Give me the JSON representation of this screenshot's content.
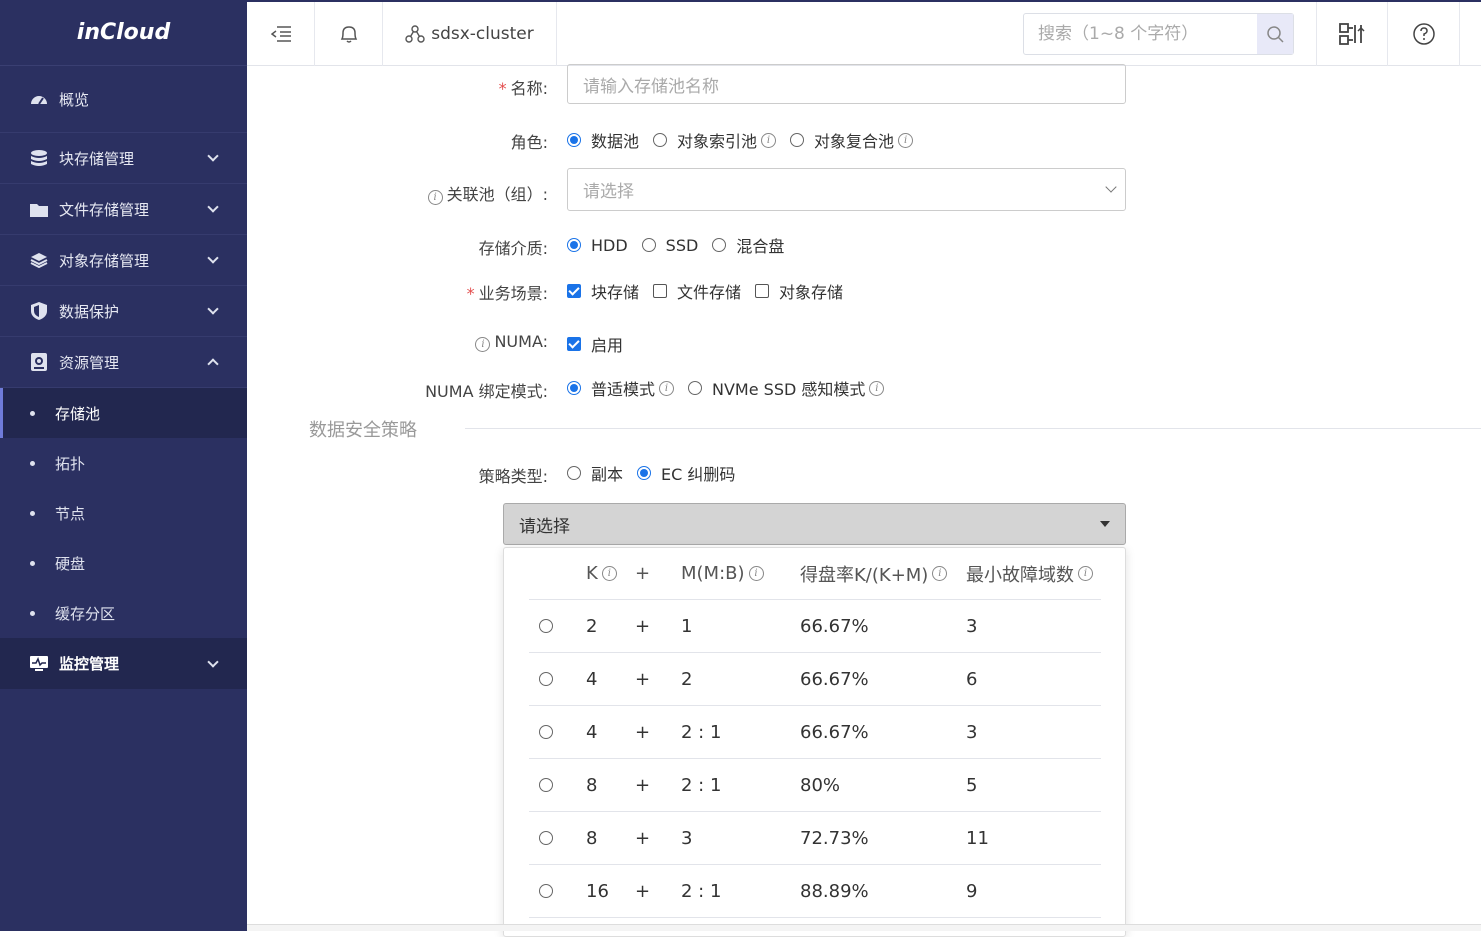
{
  "brand": {
    "logo_text": "inCloud"
  },
  "sidebar": {
    "items": [
      {
        "label": "概览",
        "icon": "dashboard-icon"
      },
      {
        "label": "块存储管理",
        "icon": "block-storage-icon"
      },
      {
        "label": "文件存储管理",
        "icon": "folder-icon"
      },
      {
        "label": "对象存储管理",
        "icon": "layers-icon"
      },
      {
        "label": "数据保护",
        "icon": "shield-icon"
      },
      {
        "label": "资源管理",
        "icon": "resource-icon"
      }
    ],
    "sub_items": [
      "存储池",
      "拓扑",
      "节点",
      "硬盘",
      "缓存分区"
    ],
    "monitor": {
      "label": "监控管理",
      "icon": "monitor-icon"
    }
  },
  "topbar": {
    "cluster": "sdsx-cluster",
    "search_placeholder": "搜索（1~8 个字符）"
  },
  "form": {
    "name": {
      "label": "名称:",
      "placeholder": "请输入存储池名称"
    },
    "role": {
      "label": "角色:",
      "options": [
        "数据池",
        "对象索引池",
        "对象复合池"
      ],
      "selected": 0
    },
    "linked_pool": {
      "label": "关联池（组）:",
      "placeholder": "请选择"
    },
    "media": {
      "label": "存储介质:",
      "options": [
        "HDD",
        "SSD",
        "混合盘"
      ],
      "selected": 0
    },
    "scenario": {
      "label": "业务场景:",
      "options": [
        "块存储",
        "文件存储",
        "对象存储"
      ],
      "checked": [
        true,
        false,
        false
      ]
    },
    "numa": {
      "label": "NUMA:",
      "option": "启用",
      "checked": true
    },
    "numa_mode": {
      "label": "NUMA 绑定模式:",
      "options": [
        "普适模式",
        "NVMe SSD 感知模式"
      ],
      "selected": 0
    },
    "section_title": "数据安全策略",
    "policy": {
      "label": "策略类型:",
      "options": [
        "副本",
        "EC 纠删码"
      ],
      "selected": 1
    },
    "ec_select": {
      "placeholder": "请选择"
    }
  },
  "ec_table": {
    "headers": {
      "k": "K",
      "plus": "+",
      "m": "M(M:B)",
      "rate": "得盘率K/(K+M)",
      "min": "最小故障域数"
    },
    "rows": [
      {
        "k": "2",
        "m": "1",
        "rate": "66.67%",
        "min": "3"
      },
      {
        "k": "4",
        "m": "2",
        "rate": "66.67%",
        "min": "6"
      },
      {
        "k": "4",
        "m": "2 : 1",
        "rate": "66.67%",
        "min": "3"
      },
      {
        "k": "8",
        "m": "2 : 1",
        "rate": "80%",
        "min": "5"
      },
      {
        "k": "8",
        "m": "3",
        "rate": "72.73%",
        "min": "11"
      },
      {
        "k": "16",
        "m": "2 : 1",
        "rate": "88.89%",
        "min": "9"
      }
    ]
  },
  "colors": {
    "sidebar_bg": "#2b3061",
    "accent": "#1a73e8",
    "required": "#e34d4d"
  }
}
